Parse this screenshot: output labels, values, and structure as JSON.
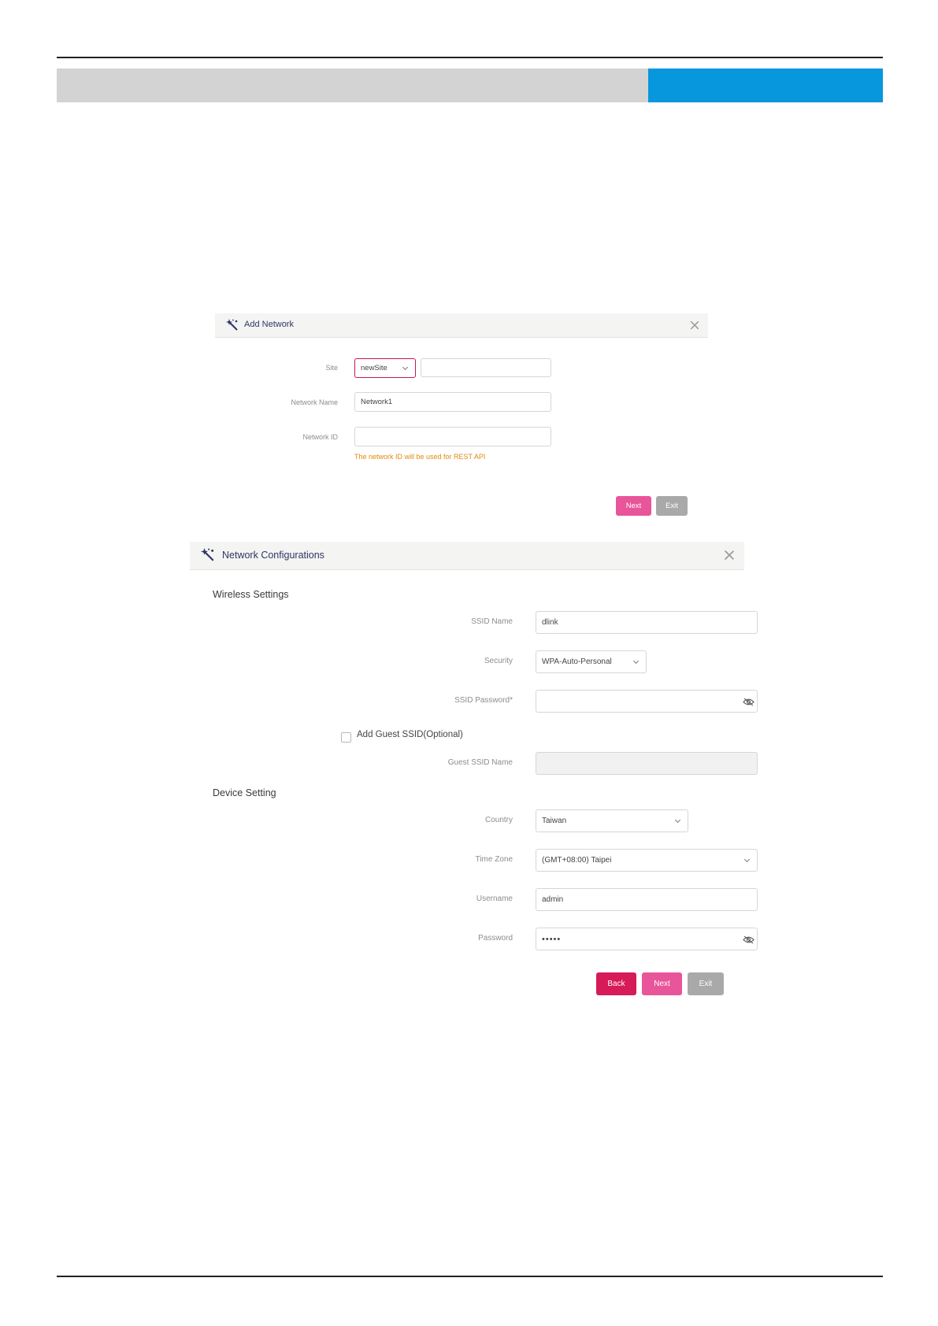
{
  "add_network": {
    "title": "Add Network",
    "site_label": "Site",
    "site_value": "newSite",
    "site_extra_value": "",
    "network_name_label": "Network Name",
    "network_name_value": "Network1",
    "network_id_label": "Network ID",
    "network_id_value": "",
    "network_id_hint": "The network ID will be used for REST API",
    "next_label": "Next",
    "exit_label": "Exit"
  },
  "network_config": {
    "title": "Network Configurations",
    "wireless_section": "Wireless Settings",
    "ssid_name_label": "SSID Name",
    "ssid_name_value": "dlink",
    "security_label": "Security",
    "security_value": "WPA-Auto-Personal",
    "ssid_password_label": "SSID Password*",
    "ssid_password_value": "",
    "guest_checkbox_label": "Add Guest SSID(Optional)",
    "guest_checked": false,
    "guest_ssid_label": "Guest SSID Name",
    "guest_ssid_value": "",
    "device_section": "Device Setting",
    "country_label": "Country",
    "country_value": "Taiwan",
    "timezone_label": "Time Zone",
    "timezone_value": "(GMT+08:00) Taipei",
    "username_label": "Username",
    "username_value": "admin",
    "password_label": "Password",
    "password_value": "•••••",
    "back_label": "Back",
    "next_label": "Next",
    "exit_label": "Exit"
  },
  "icons": {
    "wizard": "magic-wand-icon",
    "close": "close-icon",
    "dropdown": "chevron-down-icon",
    "visibility": "eye-off-icon"
  },
  "colors": {
    "header_gray": "#d3d3d3",
    "header_blue": "#0797dd",
    "primary_pink": "#e9559a",
    "back_crimson": "#d71a58",
    "exit_gray": "#a9a9a9",
    "hint_orange": "#e08a0b",
    "title_navy": "#2f3567"
  }
}
